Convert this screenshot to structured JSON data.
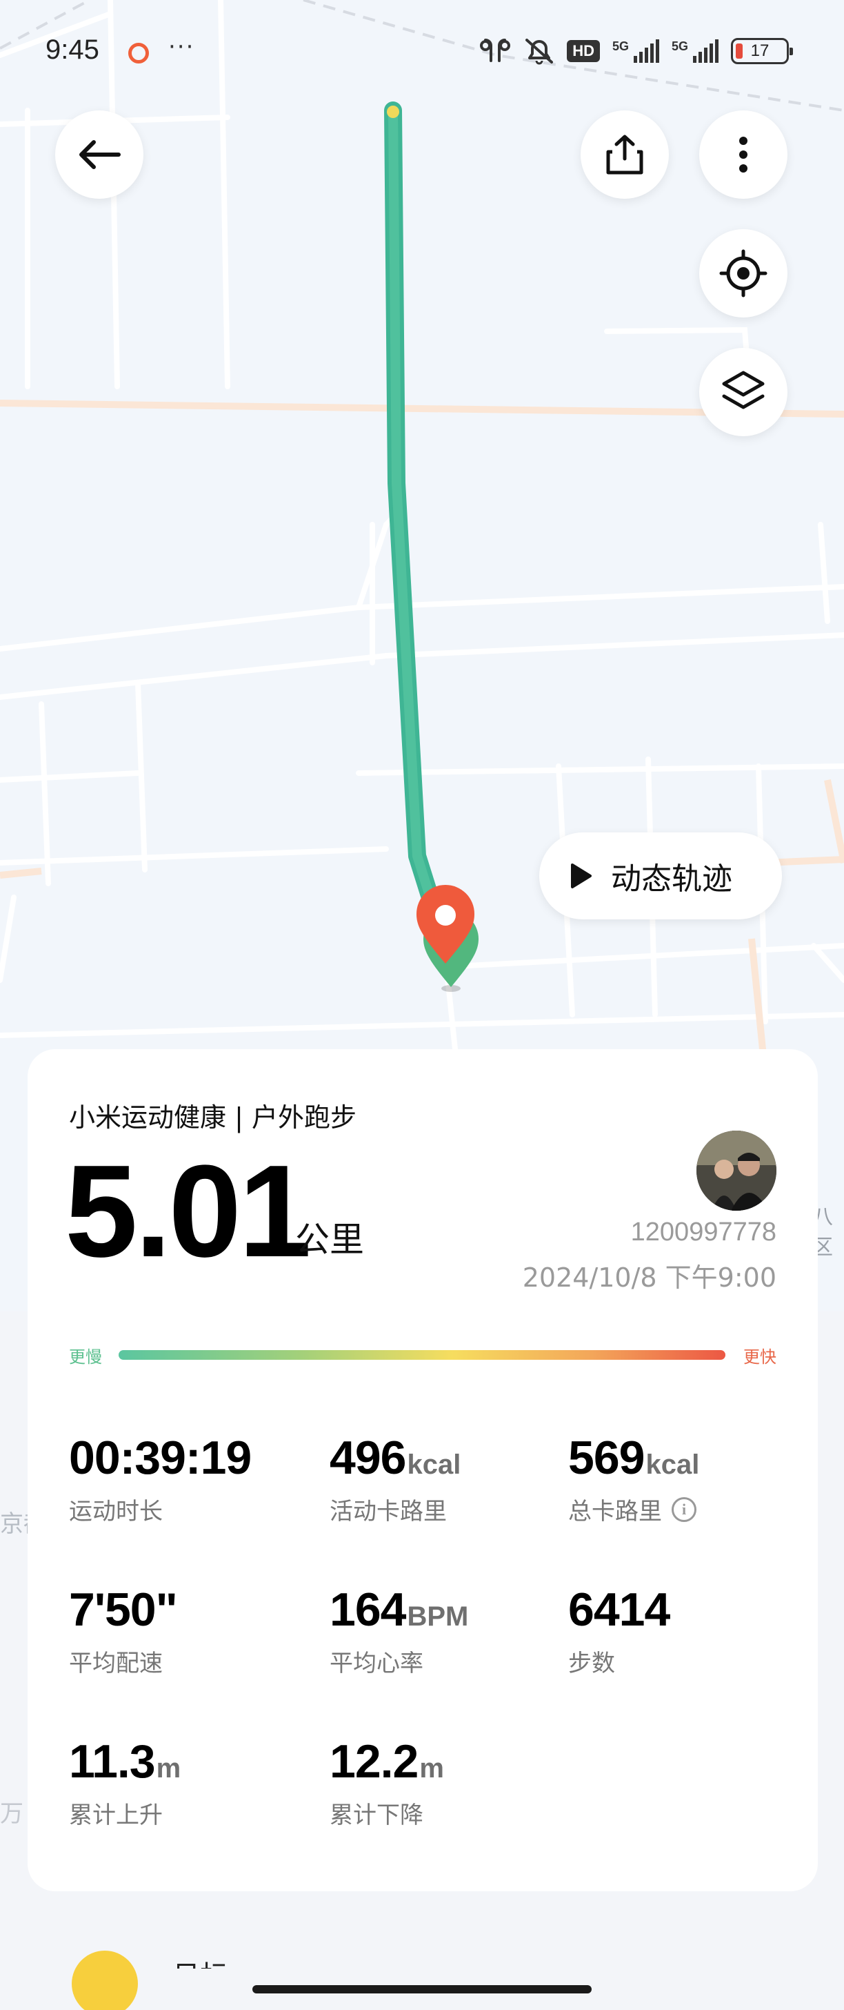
{
  "status_bar": {
    "time": "9:45",
    "more": "···",
    "hd_label": "HD",
    "network_1": "5G",
    "network_2": "5G",
    "battery": "17"
  },
  "map": {
    "dynamic_track_label": "动态轨迹",
    "district_fragment_right": "八区",
    "district_fragment_left_1": "京都",
    "district_fragment_left_2": "万"
  },
  "summary": {
    "source": "小米运动健康 | 户外跑步",
    "distance": "5.01",
    "distance_unit": "公里",
    "user_id": "1200997778",
    "datetime": "2024/10/8 下午9:00",
    "pace_slow_label": "更慢",
    "pace_fast_label": "更快",
    "stats": [
      {
        "value": "00:39:19",
        "unit": "",
        "label": "运动时长"
      },
      {
        "value": "496",
        "unit": "kcal",
        "label": "活动卡路里"
      },
      {
        "value": "569",
        "unit": "kcal",
        "label": "总卡路里"
      },
      {
        "value": "7'50\"",
        "unit": "",
        "label": "平均配速"
      },
      {
        "value": "164",
        "unit": "BPM",
        "label": "平均心率"
      },
      {
        "value": "6414",
        "unit": "",
        "label": "步数"
      },
      {
        "value": "11.3",
        "unit": "m",
        "label": "累计上升"
      },
      {
        "value": "12.2",
        "unit": "m",
        "label": "累计下降"
      }
    ]
  },
  "bottom_peek": {
    "text": "日标"
  },
  "colors": {
    "route": "#4ebf98",
    "start_marker": "#ef5a3c",
    "end_marker": "#52b77e",
    "pace_slow": "#5cc08f",
    "pace_fast": "#e8684a"
  },
  "icons": [
    "back-arrow-icon",
    "share-icon",
    "more-vertical-icon",
    "locate-icon",
    "layers-icon",
    "play-icon",
    "info-icon"
  ]
}
